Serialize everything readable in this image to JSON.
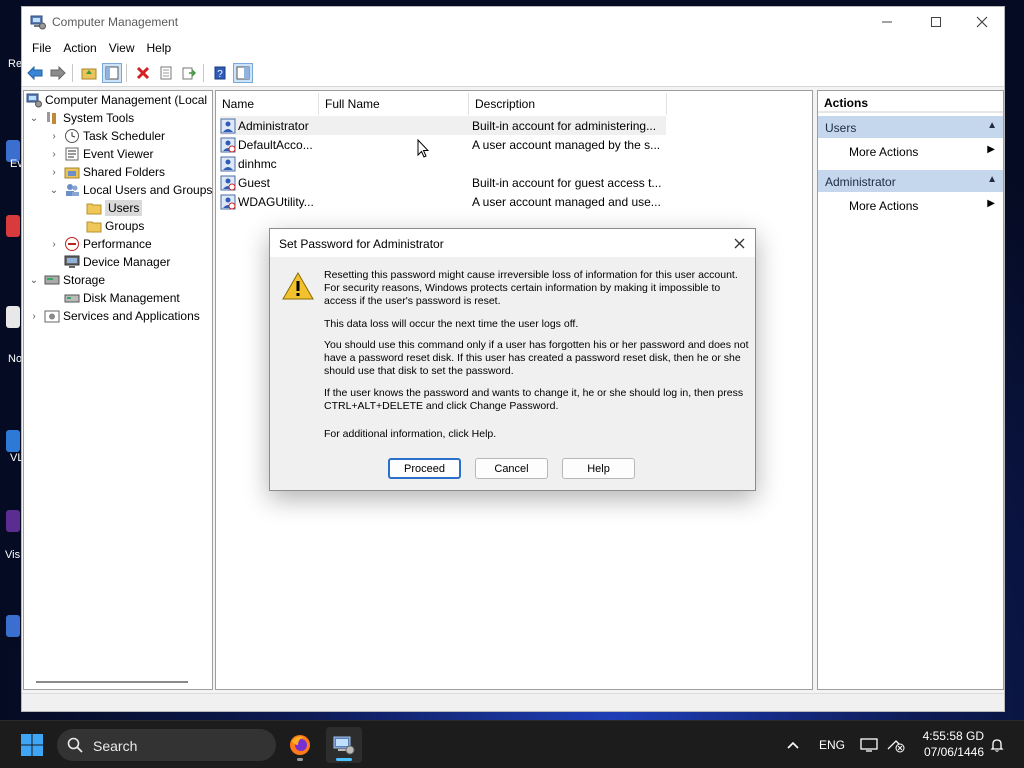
{
  "window": {
    "title": "Computer Management",
    "menu": [
      "File",
      "Action",
      "View",
      "Help"
    ]
  },
  "tree": {
    "items": [
      {
        "label": "Computer Management (Local",
        "icon": "computer-management-icon"
      },
      {
        "label": "System Tools",
        "icon": "system-tools-icon"
      },
      {
        "label": "Task Scheduler",
        "icon": "clock-icon"
      },
      {
        "label": "Event Viewer",
        "icon": "event-viewer-icon"
      },
      {
        "label": "Shared Folders",
        "icon": "shared-folders-icon"
      },
      {
        "label": "Local Users and Groups",
        "icon": "users-group-icon"
      },
      {
        "label": "Users",
        "icon": "folder-icon"
      },
      {
        "label": "Groups",
        "icon": "folder-icon"
      },
      {
        "label": "Performance",
        "icon": "performance-icon"
      },
      {
        "label": "Device Manager",
        "icon": "device-manager-icon"
      },
      {
        "label": "Storage",
        "icon": "storage-icon"
      },
      {
        "label": "Disk Management",
        "icon": "disk-icon"
      },
      {
        "label": "Services and Applications",
        "icon": "services-icon"
      }
    ]
  },
  "list": {
    "columns": [
      "Name",
      "Full Name",
      "Description"
    ],
    "rows": [
      {
        "name": "Administrator",
        "full_name": "",
        "description": "Built-in account for administering..."
      },
      {
        "name": "DefaultAcco...",
        "full_name": "",
        "description": "A user account managed by the s..."
      },
      {
        "name": "dinhmc",
        "full_name": "",
        "description": ""
      },
      {
        "name": "Guest",
        "full_name": "",
        "description": "Built-in account for guest access t..."
      },
      {
        "name": "WDAGUtility...",
        "full_name": "",
        "description": "A user account managed and use..."
      }
    ]
  },
  "actions": {
    "header": "Actions",
    "sections": [
      {
        "title": "Users",
        "item": "More Actions"
      },
      {
        "title": "Administrator",
        "item": "More Actions"
      }
    ]
  },
  "dialog": {
    "title": "Set Password for Administrator",
    "paragraphs": [
      "Resetting this password might cause irreversible loss of information for this user account. For security reasons, Windows protects certain information by making it impossible to access if the user's password is reset.",
      "This data loss will occur the next time the user logs off.",
      "You should use this command only if a user has forgotten his or her password and does not have a password reset disk. If this user has created a password reset disk, then he or she should use that disk to set the password.",
      "If the user knows the password and wants to change it, he or she should log in, then press CTRL+ALT+DELETE and click Change Password.",
      "For additional information, click Help."
    ],
    "buttons": {
      "proceed": "Proceed",
      "cancel": "Cancel",
      "help": "Help"
    }
  },
  "desktop": {
    "icon_labels": [
      "Re",
      "Ev",
      "No",
      "VL",
      "Vis"
    ]
  },
  "taskbar": {
    "search_placeholder": "Search",
    "language": "ENG",
    "time": "4:55:58 GD",
    "date": "07/06/1446"
  },
  "colors": {
    "accent": "#2a6fc9",
    "action_section": "#c4d7ec",
    "taskbar": "#1c1c1c"
  }
}
